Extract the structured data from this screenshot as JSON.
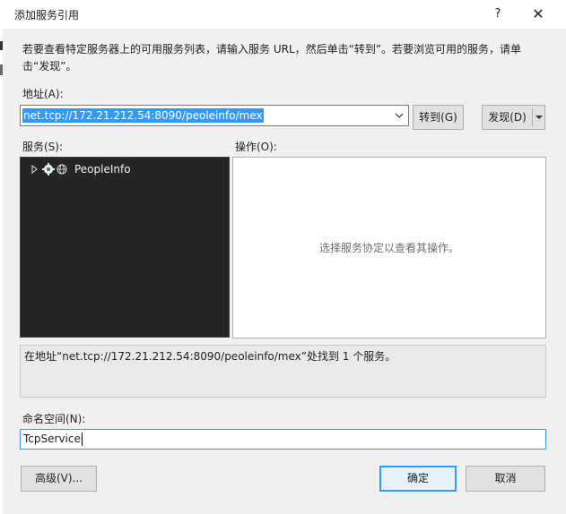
{
  "dialog": {
    "title": "添加服务引用",
    "help_glyph": "?",
    "close_glyph": "✕"
  },
  "instructions": "若要查看特定服务器上的可用服务列表，请输入服务 URL，然后单击“转到”。若要浏览可用的服务，请单击“发现”。",
  "address": {
    "label": "地址(A):",
    "value": "net.tcp://172.21.212.54:8090/peoleinfo/mex",
    "go_label": "转到(G)",
    "discover_label": "发现(D)"
  },
  "services": {
    "label": "服务(S):",
    "items": [
      {
        "label": "PeopleInfo",
        "icons": [
          "gear-icon",
          "globe-icon"
        ],
        "expanded": false
      }
    ]
  },
  "operations": {
    "label": "操作(O):",
    "hint": "选择服务协定以查看其操作。"
  },
  "status": "在地址“net.tcp://172.21.212.54:8090/peoleinfo/mex”处找到 1 个服务。",
  "namespace": {
    "label": "命名空间(N):",
    "value": "TcpService"
  },
  "buttons": {
    "advanced": "高级(V)...",
    "ok": "确定",
    "cancel": "取消"
  },
  "colors": {
    "selection": "#3399ff",
    "tree_background": "#252526",
    "dialog_background": "#f0f0f0"
  }
}
